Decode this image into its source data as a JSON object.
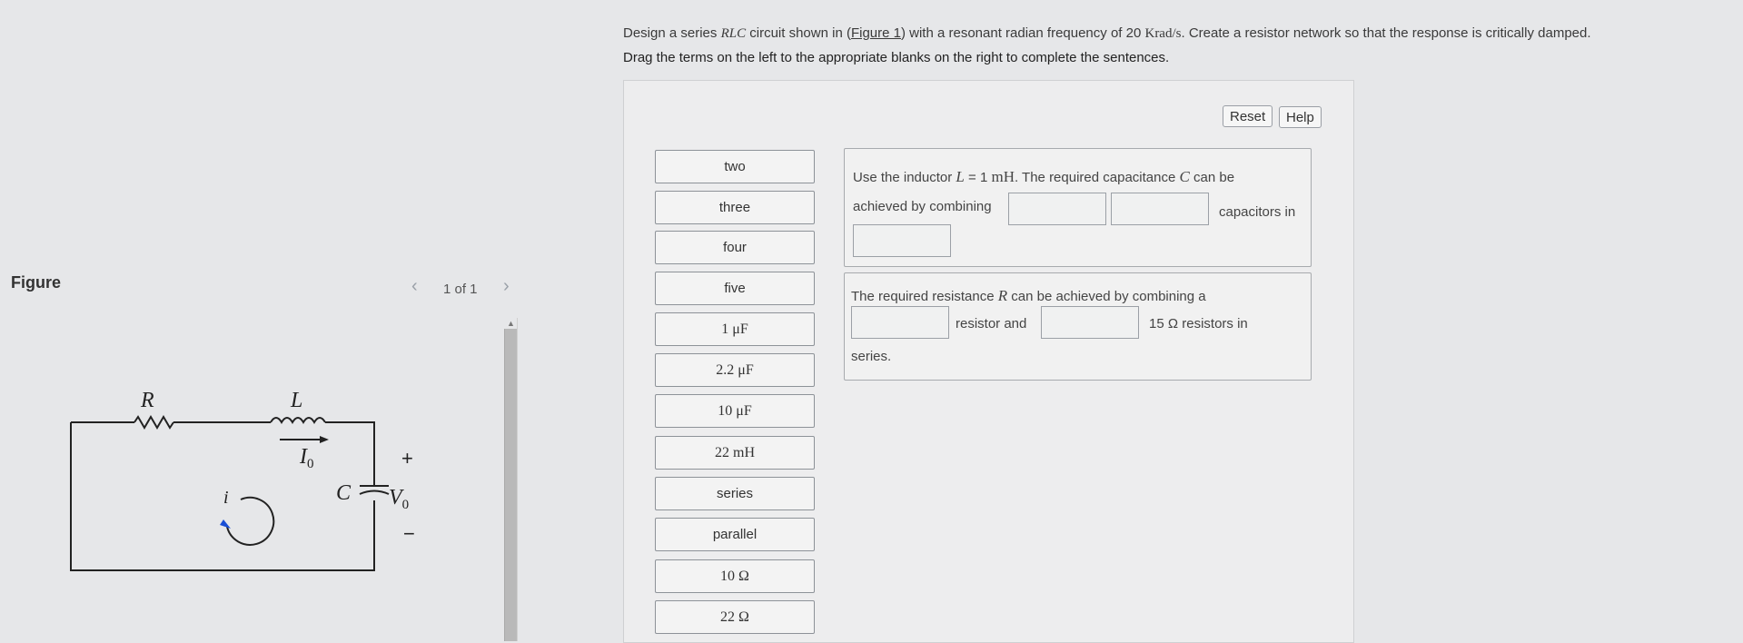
{
  "question": {
    "part1": "Design a series ",
    "rlc": "RLC",
    "part2": " circuit shown in (",
    "figure_link": "Figure 1",
    "part3": ") with a resonant radian frequency of 20 ",
    "krad": "Krad/s",
    "part4": ". Create a resistor network so that the response is critically damped."
  },
  "instructions": "Drag the terms on the left to the appropriate blanks on the right to complete the sentences.",
  "toolbar": {
    "reset_label": "Reset",
    "help_label": "Help"
  },
  "terms": [
    {
      "label": "two"
    },
    {
      "label": "three"
    },
    {
      "label": "four"
    },
    {
      "label": "five"
    },
    {
      "label": "1 μF"
    },
    {
      "label": "2.2 μF"
    },
    {
      "label": "10 μF"
    },
    {
      "label": "22 mH"
    },
    {
      "label": "series"
    },
    {
      "label": "parallel"
    },
    {
      "label": "10 Ω"
    },
    {
      "label": "22 Ω"
    }
  ],
  "sentence1": {
    "t1": "Use the inductor ",
    "var_L": "L",
    "t2": " = 1 ",
    "unit": "mH",
    "t3": ". The required capacitance ",
    "var_C": "C",
    "t4": " can be",
    "t5": "achieved by combining",
    "t6": "capacitors in"
  },
  "sentence2": {
    "t1": "The required resistance ",
    "var_R": "R",
    "t2": " can be achieved by combining a",
    "t3": "resistor and",
    "t4": "15 Ω resistors in",
    "t5": "series."
  },
  "figure": {
    "label": "Figure",
    "pager": "1 of 1",
    "circuit": {
      "R": "R",
      "L": "L",
      "I0": "I",
      "I0_sub": "0",
      "i": "i",
      "C": "C",
      "V0": "V",
      "V0_sub": "0",
      "plus": "+",
      "minus": "−"
    }
  }
}
